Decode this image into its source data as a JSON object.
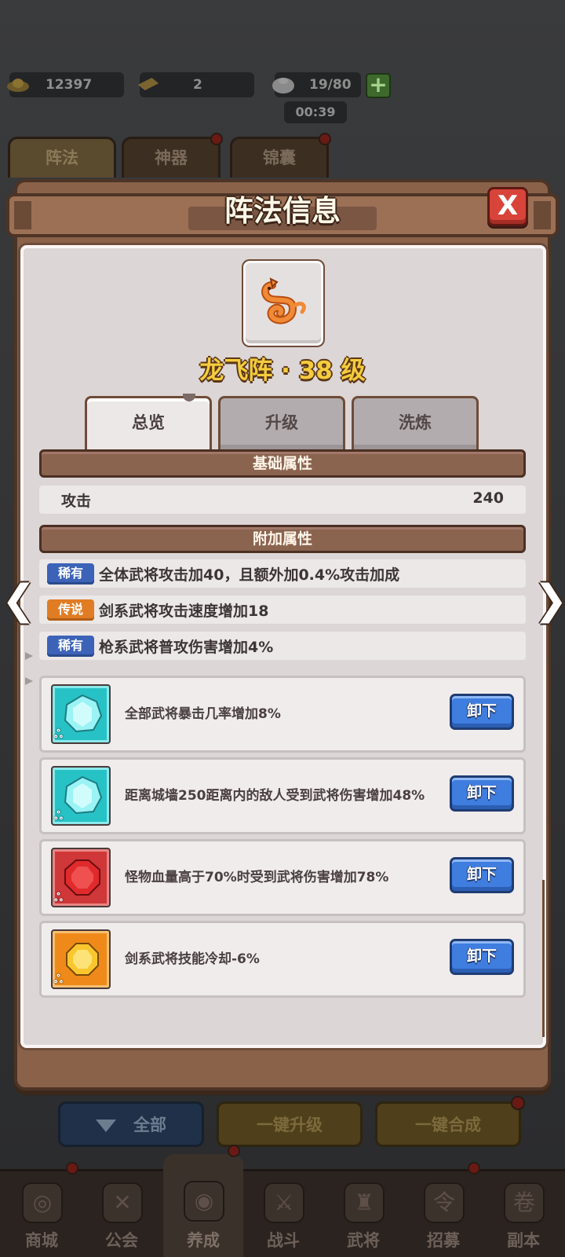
{
  "resources": {
    "gold": "12397",
    "tickets": "2",
    "stamina": "19/80",
    "timer": "00:39"
  },
  "top_tabs": [
    "阵法",
    "神器",
    "锦囊"
  ],
  "modal": {
    "title": "阵法信息",
    "close_label": "X",
    "formation_name": "龙飞阵 · 38 级",
    "sub_tabs": [
      "总览",
      "升级",
      "洗炼"
    ],
    "basic_header": "基础属性",
    "basic_stats": [
      {
        "label": "攻击",
        "value": "240"
      }
    ],
    "extra_header": "附加属性",
    "extra_attrs": [
      {
        "rarity": "稀有",
        "text": "全体武将攻击加40，且额外加0.4%攻击加成",
        "color": "#3c63b8"
      },
      {
        "rarity": "传说",
        "text": "剑系武将攻击速度增加18",
        "color": "#e07d24"
      },
      {
        "rarity": "稀有",
        "text": "枪系武将普攻伤害增加4%",
        "color": "#3c63b8"
      }
    ],
    "gems": [
      {
        "icon": "cyan-gem-icon",
        "desc": "全部武将暴击几率增加8%",
        "button": "卸下"
      },
      {
        "icon": "cyan-gem-icon",
        "desc": "距离城墙250距离内的敌人受到武将伤害增加48%",
        "button": "卸下"
      },
      {
        "icon": "red-gem-icon",
        "desc": "怪物血量高于70%时受到武将伤害增加78%",
        "button": "卸下"
      },
      {
        "icon": "orange-gem-icon",
        "desc": "剑系武将技能冷却-6%",
        "button": "卸下"
      }
    ]
  },
  "bottom_buttons": {
    "all": "全部",
    "upgrade": "一键升级",
    "merge": "一键合成"
  },
  "nav": [
    "商城",
    "公会",
    "养成",
    "战斗",
    "武将",
    "招募",
    "副本"
  ],
  "colors": {
    "rare": "#3c63b8",
    "legend": "#e07d24",
    "title_gold": "#f4cc3d",
    "close_red": "#d8443a",
    "unequip_blue": "#3f7ddf"
  }
}
